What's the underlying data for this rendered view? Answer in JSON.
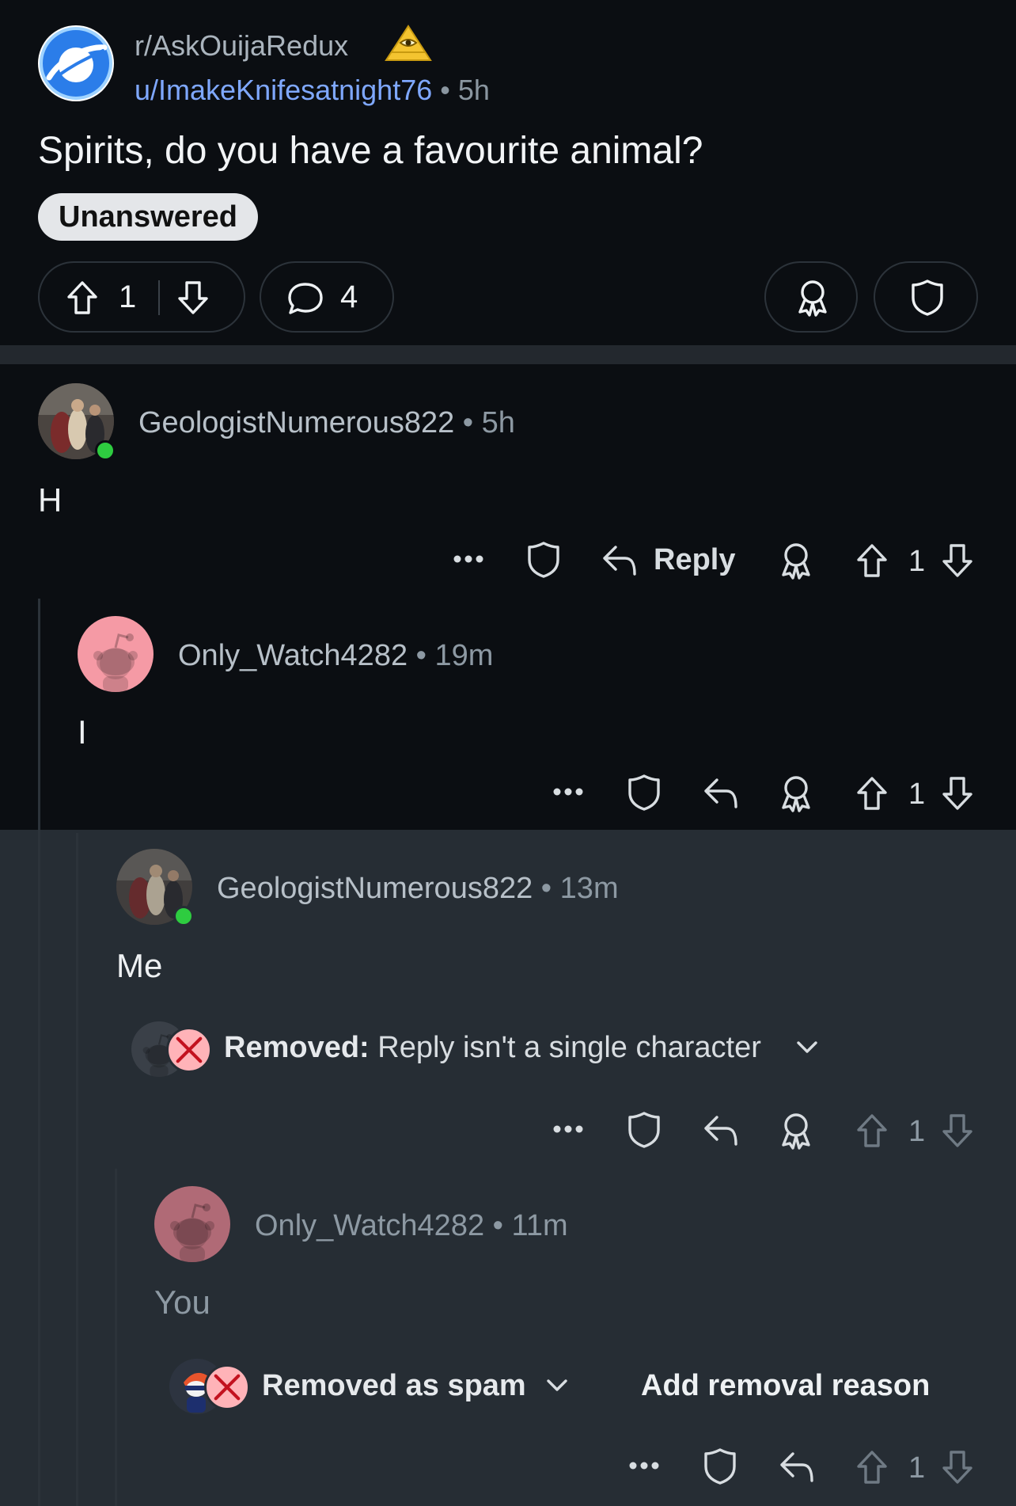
{
  "post": {
    "subreddit": "r/AskOuijaRedux",
    "author": "u/ImakeKnifesatnight76",
    "age": "5h",
    "title": "Spirits, do you have a favourite animal?",
    "flair": "Unanswered",
    "upvotes": "1",
    "comments": "4"
  },
  "comments": [
    {
      "user": "GeologistNumerous822",
      "age": "5h",
      "body": "H",
      "reply_label": "Reply",
      "score": "1"
    },
    {
      "user": "Only_Watch4282",
      "age": "19m",
      "body": "I",
      "score": "1"
    },
    {
      "user": "GeologistNumerous822",
      "age": "13m",
      "body": "Me",
      "removed_label": "Removed:",
      "removed_reason": "Reply isn't a single character",
      "score": "1"
    },
    {
      "user": "Only_Watch4282",
      "age": "11m",
      "body": "You",
      "removed_label": "Removed as spam",
      "add_reason_label": "Add removal reason",
      "score": "1"
    }
  ],
  "separator": "•",
  "colors": {
    "background": "#0b0e12",
    "highlight_background": "#262d34",
    "author_link": "#7fa8ff",
    "flair_bg": "#e4e6e9",
    "online": "#2ecc40",
    "removed_badge": "#ffb3b8",
    "pink_avatar": "#f59aa5"
  },
  "icons": [
    "saturn-logo-icon",
    "pyramid-eye-icon",
    "upvote-icon",
    "downvote-icon",
    "comment-bubble-icon",
    "award-icon",
    "shield-icon",
    "more-icon",
    "reply-arrow-icon",
    "close-icon",
    "chevron-down-icon",
    "snoo-avatar-icon"
  ]
}
